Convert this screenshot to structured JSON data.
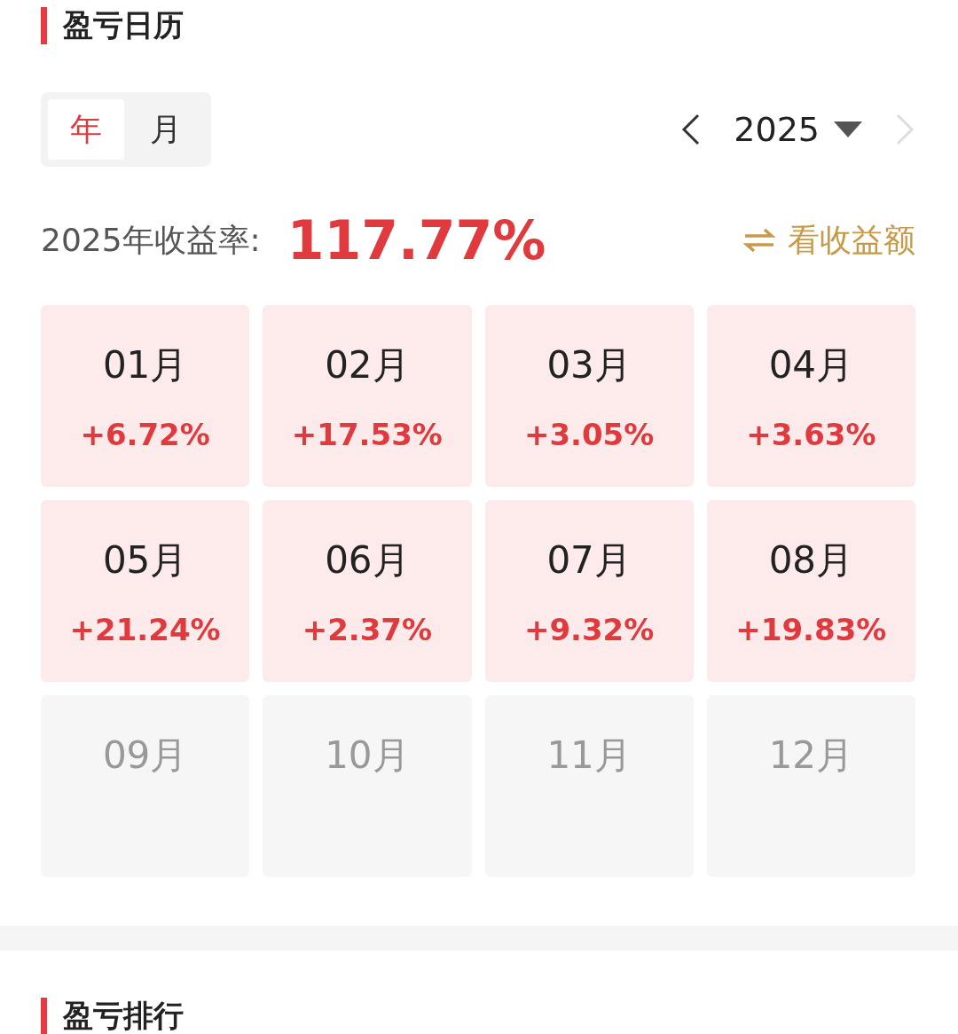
{
  "calendar_section": {
    "title": "盈亏日历",
    "period_tabs": [
      {
        "label": "年",
        "selected": true
      },
      {
        "label": "月",
        "selected": false
      }
    ],
    "year_nav": {
      "year": "2025",
      "prev_disabled": false,
      "next_disabled": true
    },
    "summary": {
      "label": "2025年收益率:",
      "value": "117.77%",
      "switch_link": "看收益额"
    },
    "months": [
      {
        "label": "01月",
        "value": "+6.72%",
        "kind": "filled"
      },
      {
        "label": "02月",
        "value": "+17.53%",
        "kind": "filled"
      },
      {
        "label": "03月",
        "value": "+3.05%",
        "kind": "filled"
      },
      {
        "label": "04月",
        "value": "+3.63%",
        "kind": "filled"
      },
      {
        "label": "05月",
        "value": "+21.24%",
        "kind": "filled"
      },
      {
        "label": "06月",
        "value": "+2.37%",
        "kind": "filled"
      },
      {
        "label": "07月",
        "value": "+9.32%",
        "kind": "filled"
      },
      {
        "label": "08月",
        "value": "+19.83%",
        "kind": "filled"
      },
      {
        "label": "09月",
        "kind": "empty"
      },
      {
        "label": "10月",
        "kind": "empty"
      },
      {
        "label": "11月",
        "kind": "empty"
      },
      {
        "label": "12月",
        "kind": "empty"
      }
    ]
  },
  "ranking_section": {
    "title": "盈亏排行"
  }
}
